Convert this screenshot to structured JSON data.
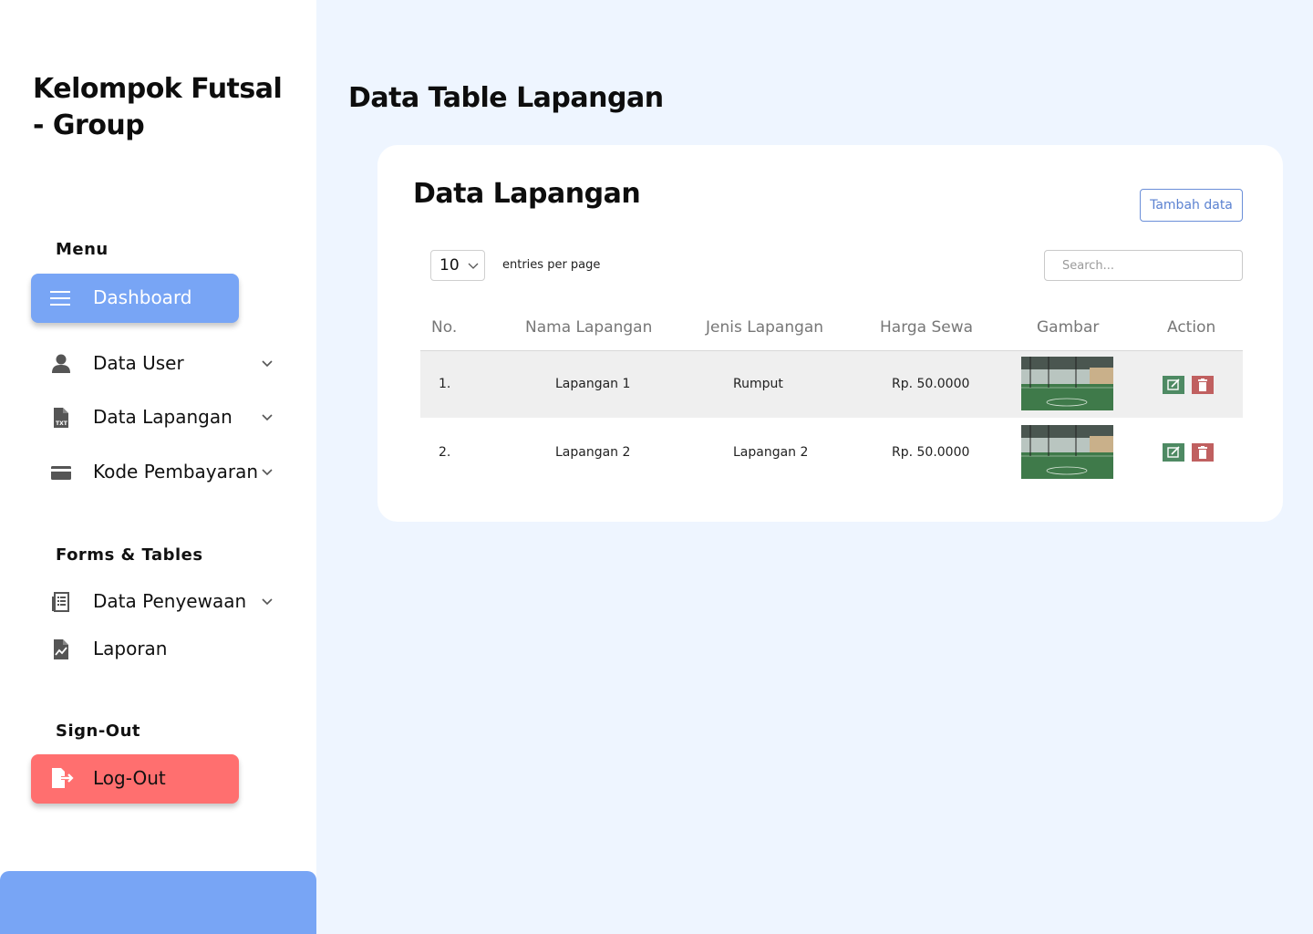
{
  "sidebar": {
    "brand": "Kelompok Futsal - Group",
    "menu_label": "Menu",
    "items": [
      {
        "label": "Dashboard",
        "icon": "menu-icon",
        "active": true
      },
      {
        "label": "Data User",
        "icon": "user-icon"
      },
      {
        "label": "Data Lapangan",
        "icon": "file-txt-icon"
      },
      {
        "label": "Kode Pembayaran",
        "icon": "card-icon"
      }
    ],
    "forms_label": "Forms & Tables",
    "forms_items": [
      {
        "label": "Data Penyewaan",
        "icon": "receipt-icon"
      },
      {
        "label": "Laporan",
        "icon": "report-icon"
      }
    ],
    "signout_label": "Sign-Out",
    "logout_label": "Log-Out"
  },
  "main": {
    "page_title": "Data Table Lapangan",
    "card_title": "Data Lapangan",
    "add_button": "Tambah data",
    "entries_value": "10",
    "entries_label": "entries per page",
    "search_placeholder": "Search..."
  },
  "table": {
    "headers": [
      "No.",
      "Nama Lapangan",
      "Jenis Lapangan",
      "Harga Sewa",
      "Gambar",
      "Action"
    ],
    "rows": [
      {
        "no": "1.",
        "nama": "Lapangan 1",
        "jenis": "Rumput",
        "harga": "Rp. 50.0000"
      },
      {
        "no": "2.",
        "nama": "Lapangan 2",
        "jenis": "Lapangan 2",
        "harga": "Rp. 50.0000"
      }
    ]
  },
  "colors": {
    "accent": "#78a5f5",
    "danger": "#ff6f6f",
    "edit": "#4e8a63",
    "delete": "#c06060",
    "background": "#eef5ff"
  }
}
